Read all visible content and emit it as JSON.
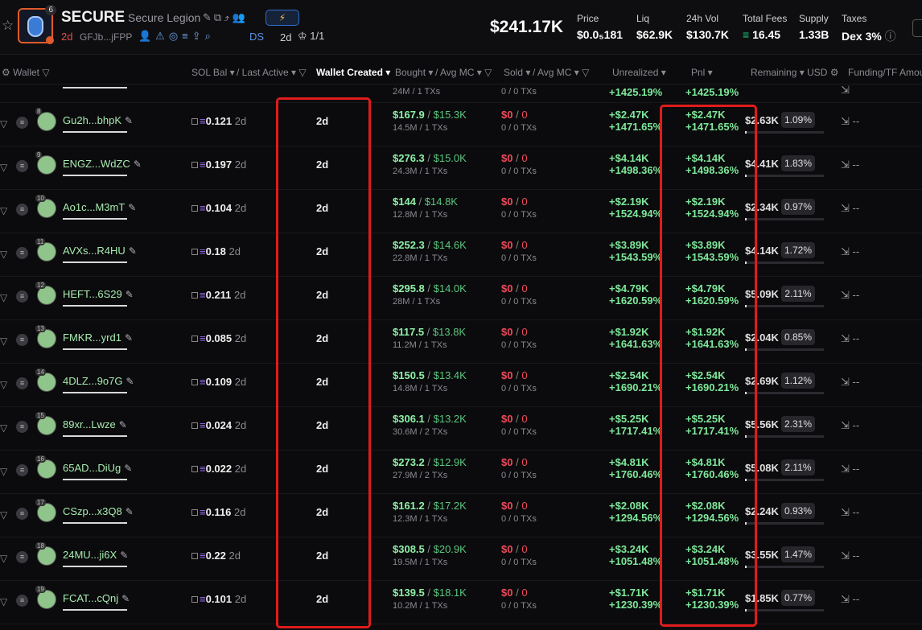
{
  "header": {
    "symbol": "SECURE",
    "name": "Secure Legion",
    "holders_badge": "6",
    "age": "2d",
    "address": "GFJb...jFPP",
    "ds_label": "DS",
    "ds_age": "2d",
    "top10": "1/1",
    "market_cap": "$241.17K",
    "stats": [
      {
        "label": "Price",
        "value": "$0.0₅181"
      },
      {
        "label": "Liq",
        "value": "$62.9K"
      },
      {
        "label": "24h Vol",
        "value": "$130.7K"
      },
      {
        "label": "Total Fees",
        "value": "16.45"
      },
      {
        "label": "Supply",
        "value": "1.33B"
      },
      {
        "label": "Taxes",
        "value": "Dex 3%"
      }
    ]
  },
  "columns": {
    "wallet": "Wallet",
    "sol_bal": "SOL Bal",
    "last_active": "/ Last Active",
    "wallet_created": "Wallet Created",
    "bought": "Bought",
    "avg_mc_buy": "/ Avg MC",
    "sold": "Sold",
    "avg_mc_sell": "/ Avg MC",
    "unrealized": "Unrealized",
    "pnl": "Pnl",
    "remaining": "Remaining",
    "usd": "USD",
    "funding": "Funding/TF Amou"
  },
  "partial_row": {
    "bought_sub": "24M / 1 TXs",
    "sold_sub": "0 / 0 TXs",
    "unrealized": "+1425.19%",
    "pnl": "+1425.19%"
  },
  "rows": [
    {
      "rank": "8",
      "wallet": "Gu2h...bhpK",
      "bal": "0.121",
      "last": "2d",
      "created": "2d",
      "bought": "$167.9",
      "bmc": "$15.3K",
      "bsub": "14.5M / 1 TXs",
      "sold": "$0",
      "smc": "0",
      "ssub": "0 / 0 TXs",
      "unr": "+$2.47K",
      "unrp": "+1471.65%",
      "pnl": "+$2.47K",
      "pnlp": "+1471.65%",
      "rem": "$2.63K",
      "pct": "1.09%",
      "fund": "--"
    },
    {
      "rank": "9",
      "wallet": "ENGZ...WdZC",
      "bal": "0.197",
      "last": "2d",
      "created": "2d",
      "bought": "$276.3",
      "bmc": "$15.0K",
      "bsub": "24.3M / 1 TXs",
      "sold": "$0",
      "smc": "0",
      "ssub": "0 / 0 TXs",
      "unr": "+$4.14K",
      "unrp": "+1498.36%",
      "pnl": "+$4.14K",
      "pnlp": "+1498.36%",
      "rem": "$4.41K",
      "pct": "1.83%",
      "fund": "--"
    },
    {
      "rank": "10",
      "wallet": "Ao1c...M3mT",
      "bal": "0.104",
      "last": "2d",
      "created": "2d",
      "bought": "$144",
      "bmc": "$14.8K",
      "bsub": "12.8M / 1 TXs",
      "sold": "$0",
      "smc": "0",
      "ssub": "0 / 0 TXs",
      "unr": "+$2.19K",
      "unrp": "+1524.94%",
      "pnl": "+$2.19K",
      "pnlp": "+1524.94%",
      "rem": "$2.34K",
      "pct": "0.97%",
      "fund": "--"
    },
    {
      "rank": "11",
      "wallet": "AVXs...R4HU",
      "bal": "0.18",
      "last": "2d",
      "created": "2d",
      "bought": "$252.3",
      "bmc": "$14.6K",
      "bsub": "22.8M / 1 TXs",
      "sold": "$0",
      "smc": "0",
      "ssub": "0 / 0 TXs",
      "unr": "+$3.89K",
      "unrp": "+1543.59%",
      "pnl": "+$3.89K",
      "pnlp": "+1543.59%",
      "rem": "$4.14K",
      "pct": "1.72%",
      "fund": "--"
    },
    {
      "rank": "12",
      "wallet": "HEFT...6S29",
      "bal": "0.211",
      "last": "2d",
      "created": "2d",
      "bought": "$295.8",
      "bmc": "$14.0K",
      "bsub": "28M / 1 TXs",
      "sold": "$0",
      "smc": "0",
      "ssub": "0 / 0 TXs",
      "unr": "+$4.79K",
      "unrp": "+1620.59%",
      "pnl": "+$4.79K",
      "pnlp": "+1620.59%",
      "rem": "$5.09K",
      "pct": "2.11%",
      "fund": "--"
    },
    {
      "rank": "13",
      "wallet": "FMKR...yrd1",
      "bal": "0.085",
      "last": "2d",
      "created": "2d",
      "bought": "$117.5",
      "bmc": "$13.8K",
      "bsub": "11.2M / 1 TXs",
      "sold": "$0",
      "smc": "0",
      "ssub": "0 / 0 TXs",
      "unr": "+$1.92K",
      "unrp": "+1641.63%",
      "pnl": "+$1.92K",
      "pnlp": "+1641.63%",
      "rem": "$2.04K",
      "pct": "0.85%",
      "fund": "--"
    },
    {
      "rank": "14",
      "wallet": "4DLZ...9o7G",
      "bal": "0.109",
      "last": "2d",
      "created": "2d",
      "bought": "$150.5",
      "bmc": "$13.4K",
      "bsub": "14.8M / 1 TXs",
      "sold": "$0",
      "smc": "0",
      "ssub": "0 / 0 TXs",
      "unr": "+$2.54K",
      "unrp": "+1690.21%",
      "pnl": "+$2.54K",
      "pnlp": "+1690.21%",
      "rem": "$2.69K",
      "pct": "1.12%",
      "fund": "--"
    },
    {
      "rank": "15",
      "wallet": "89xr...Lwze",
      "bal": "0.024",
      "last": "2d",
      "created": "2d",
      "bought": "$306.1",
      "bmc": "$13.2K",
      "bsub": "30.6M / 2 TXs",
      "sold": "$0",
      "smc": "0",
      "ssub": "0 / 0 TXs",
      "unr": "+$5.25K",
      "unrp": "+1717.41%",
      "pnl": "+$5.25K",
      "pnlp": "+1717.41%",
      "rem": "$5.56K",
      "pct": "2.31%",
      "fund": "--"
    },
    {
      "rank": "16",
      "wallet": "65AD...DiUg",
      "bal": "0.022",
      "last": "2d",
      "created": "2d",
      "bought": "$273.2",
      "bmc": "$12.9K",
      "bsub": "27.9M / 2 TXs",
      "sold": "$0",
      "smc": "0",
      "ssub": "0 / 0 TXs",
      "unr": "+$4.81K",
      "unrp": "+1760.46%",
      "pnl": "+$4.81K",
      "pnlp": "+1760.46%",
      "rem": "$5.08K",
      "pct": "2.11%",
      "fund": "--"
    },
    {
      "rank": "17",
      "wallet": "CSzp...x3Q8",
      "bal": "0.116",
      "last": "2d",
      "created": "2d",
      "bought": "$161.2",
      "bmc": "$17.2K",
      "bsub": "12.3M / 1 TXs",
      "sold": "$0",
      "smc": "0",
      "ssub": "0 / 0 TXs",
      "unr": "+$2.08K",
      "unrp": "+1294.56%",
      "pnl": "+$2.08K",
      "pnlp": "+1294.56%",
      "rem": "$2.24K",
      "pct": "0.93%",
      "fund": "--"
    },
    {
      "rank": "18",
      "wallet": "24MU...ji6X",
      "bal": "0.22",
      "last": "2d",
      "created": "2d",
      "bought": "$308.5",
      "bmc": "$20.9K",
      "bsub": "19.5M / 1 TXs",
      "sold": "$0",
      "smc": "0",
      "ssub": "0 / 0 TXs",
      "unr": "+$3.24K",
      "unrp": "+1051.48%",
      "pnl": "+$3.24K",
      "pnlp": "+1051.48%",
      "rem": "$3.55K",
      "pct": "1.47%",
      "fund": "--"
    },
    {
      "rank": "19",
      "wallet": "FCAT...cQnj",
      "bal": "0.101",
      "last": "2d",
      "created": "2d",
      "bought": "$139.5",
      "bmc": "$18.1K",
      "bsub": "10.2M / 1 TXs",
      "sold": "$0",
      "smc": "0",
      "ssub": "0 / 0 TXs",
      "unr": "+$1.71K",
      "unrp": "+1230.39%",
      "pnl": "+$1.71K",
      "pnlp": "+1230.39%",
      "rem": "$1.85K",
      "pct": "0.77%",
      "fund": "--"
    }
  ],
  "colors": {
    "highlight": "#e11b1b",
    "positive": "#7ee89a",
    "negative": "#ef4a5a",
    "sol": "#9c6cf0"
  }
}
